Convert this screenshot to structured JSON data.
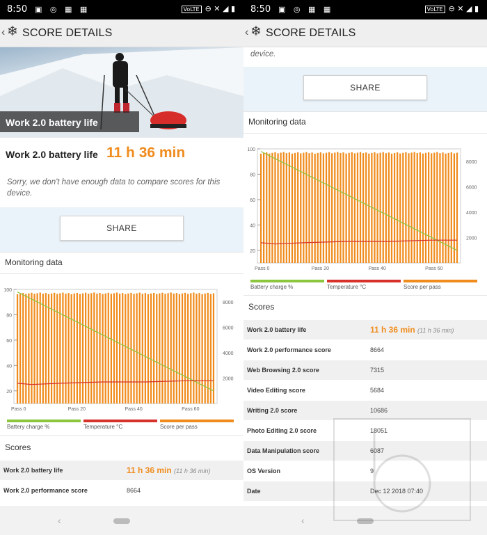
{
  "status": {
    "time": "8:50",
    "volte": "VoLTE"
  },
  "header": {
    "title": "SCORE DETAILS"
  },
  "hero": {
    "caption": "Work 2.0 battery life"
  },
  "score": {
    "label": "Work 2.0 battery life",
    "value": "11 h 36 min"
  },
  "notice": {
    "text": "Sorry, we don't have enough data to compare scores for this device.",
    "fragment": "device."
  },
  "share_label": "SHARE",
  "monitoring_title": "Monitoring data",
  "scores_title": "Scores",
  "legend": [
    "Battery charge %",
    "Temperature °C",
    "Score per pass"
  ],
  "colors": {
    "accent": "#f08c1e",
    "battery": "#8cc63f",
    "temperature": "#d7312c",
    "score_bars": "#f08c1e",
    "share_bg": "#eaf3f9"
  },
  "scores_table": [
    {
      "label": "Work 2.0 battery life",
      "value": "11 h 36 min",
      "sub": "(11 h 36 min)"
    },
    {
      "label": "Work 2.0 performance score",
      "value": "8664"
    },
    {
      "label": "Web Browsing 2.0 score",
      "value": "7315"
    },
    {
      "label": "Video Editing score",
      "value": "5684"
    },
    {
      "label": "Writing 2.0 score",
      "value": "10686"
    },
    {
      "label": "Photo Editing 2.0 score",
      "value": "18051"
    },
    {
      "label": "Data Manipulation score",
      "value": "6087"
    },
    {
      "label": "OS Version",
      "value": "9"
    },
    {
      "label": "Date",
      "value": "Dec 12 2018 07:40"
    }
  ],
  "chart_data": {
    "type": "bar",
    "x_ticks": [
      "Pass 0",
      "Pass 20",
      "Pass 40",
      "Pass 60"
    ],
    "y_left_ticks": [
      20,
      40,
      60,
      80,
      100
    ],
    "y_right_ticks": [
      2000,
      4000,
      6000,
      8000
    ],
    "ylim_left": [
      10,
      100
    ],
    "ylim_right": [
      0,
      9000
    ],
    "passes": 70,
    "series": [
      {
        "name": "Score per pass",
        "kind": "bars",
        "value_range": [
          8620,
          8760
        ],
        "typical": 8700
      },
      {
        "name": "Battery charge %",
        "kind": "line",
        "x": [
          0,
          69
        ],
        "y": [
          98,
          20
        ]
      },
      {
        "name": "Temperature °C",
        "kind": "line",
        "x": [
          0,
          5,
          15,
          30,
          45,
          60,
          69
        ],
        "y": [
          26,
          25,
          26,
          27,
          27,
          28,
          28
        ]
      }
    ]
  }
}
